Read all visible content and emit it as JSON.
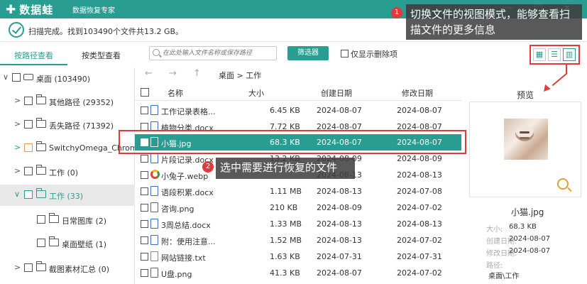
{
  "app": {
    "logo": "数据蛙",
    "subtitle": "数据恢复专家",
    "window_controls": "— □ ×"
  },
  "status": {
    "text": "扫描完成。找到103490个文件共13.2 GB。"
  },
  "left_tabs": [
    "按路径查看",
    "按类型查看"
  ],
  "tree": [
    {
      "label": "桌面 (103490)",
      "arrow": "∨",
      "kind": "drive"
    },
    {
      "label": "其他路径 (29352)",
      "arrow": ">",
      "kind": "folder"
    },
    {
      "label": "丢失路径 (71392)",
      "arrow": ">",
      "kind": "folder"
    },
    {
      "label": "SwitchyOmega_Chromium",
      "arrow": ">",
      "kind": "folder"
    },
    {
      "label": "工作 (0)",
      "arrow": ">",
      "kind": "folder"
    },
    {
      "label": "工作 (33)",
      "arrow": "∨",
      "kind": "folder"
    },
    {
      "label": "日常图库 (2)",
      "arrow": "",
      "kind": "folder"
    },
    {
      "label": "桌面壁纸 (1)",
      "arrow": "",
      "kind": "folder"
    },
    {
      "label": "截图素材汇总 (0)",
      "arrow": ">",
      "kind": "folder"
    }
  ],
  "search": {
    "placeholder": "在此处输入文件名称或保存路径"
  },
  "filter_label": "筛选器",
  "only_deleted_label": "仅显示删除项",
  "view_icons": [
    "grid-icon",
    "list-icon",
    "detail-icon"
  ],
  "nav": {
    "back": "←",
    "forward": "→",
    "up": "↑",
    "path": "桌面 > 工作"
  },
  "columns": [
    "名称",
    "大小",
    "创建日期",
    "修改日期"
  ],
  "files": [
    {
      "name": "工作记录表格...",
      "size": "6.45 KB",
      "created": "2024-08-07",
      "modified": "2024-08-07",
      "type": "doc"
    },
    {
      "name": "植物分类.docx",
      "size": "7.72 KB",
      "created": "2024-08-07",
      "modified": "2024-08-07",
      "type": "doc"
    },
    {
      "name": "小猫.jpg",
      "size": "68.3 KB",
      "created": "2024-08-07",
      "modified": "2024-08-07",
      "type": "img"
    },
    {
      "name": "片段记录.docx",
      "size": "13.2 KB",
      "created": "2024-08-09",
      "modified": "2024-08-09",
      "type": "doc"
    },
    {
      "name": "小兔子.webp",
      "size": "",
      "created": "2024-08-13",
      "modified": "2024-08-13",
      "type": "web"
    },
    {
      "name": "语段积累.docx",
      "size": "1.11 MB",
      "created": "2024-08-13",
      "modified": "2024-07-08",
      "type": "doc"
    },
    {
      "name": "咨询.png",
      "size": "210 KB",
      "created": "2024-08-09",
      "modified": "2024-07-02",
      "type": "img"
    },
    {
      "name": "3周总结.docx",
      "size": "1.33 MB",
      "created": "2024-08-13",
      "modified": "2024-08-13",
      "type": "doc"
    },
    {
      "name": "附：使用注意...",
      "size": "1.52 MB",
      "created": "2024-08-13",
      "modified": "2024-07-02",
      "type": "doc"
    },
    {
      "name": "网站链接.txt",
      "size": "1.63 KB",
      "created": "2024-07-31",
      "modified": "2024-07-31",
      "type": "txt"
    },
    {
      "name": "U盘.png",
      "size": "41.3 KB",
      "created": "2024-08-07",
      "modified": "2024-07-02",
      "type": "img"
    }
  ],
  "preview": {
    "title": "预览",
    "filename": "小猫.jpg",
    "meta": [
      {
        "k": "大小:",
        "v": "68.3 KB"
      },
      {
        "k": "创建日期:",
        "v": "2024-08-07"
      },
      {
        "k": "修改日期:",
        "v": "2024-08-07"
      },
      {
        "k": "路径:",
        "v": ""
      },
      {
        "k": "",
        "v": "桌面\\工作"
      }
    ]
  },
  "annotations": {
    "badge1": "1",
    "tip1": "切换文件的视图模式，能够查看扫描文件的更多信息",
    "badge2": "2",
    "tip2": "选中需要进行恢复的文件"
  },
  "colors": {
    "accent": "#2a9d92",
    "annotation": "#e23a3a"
  }
}
